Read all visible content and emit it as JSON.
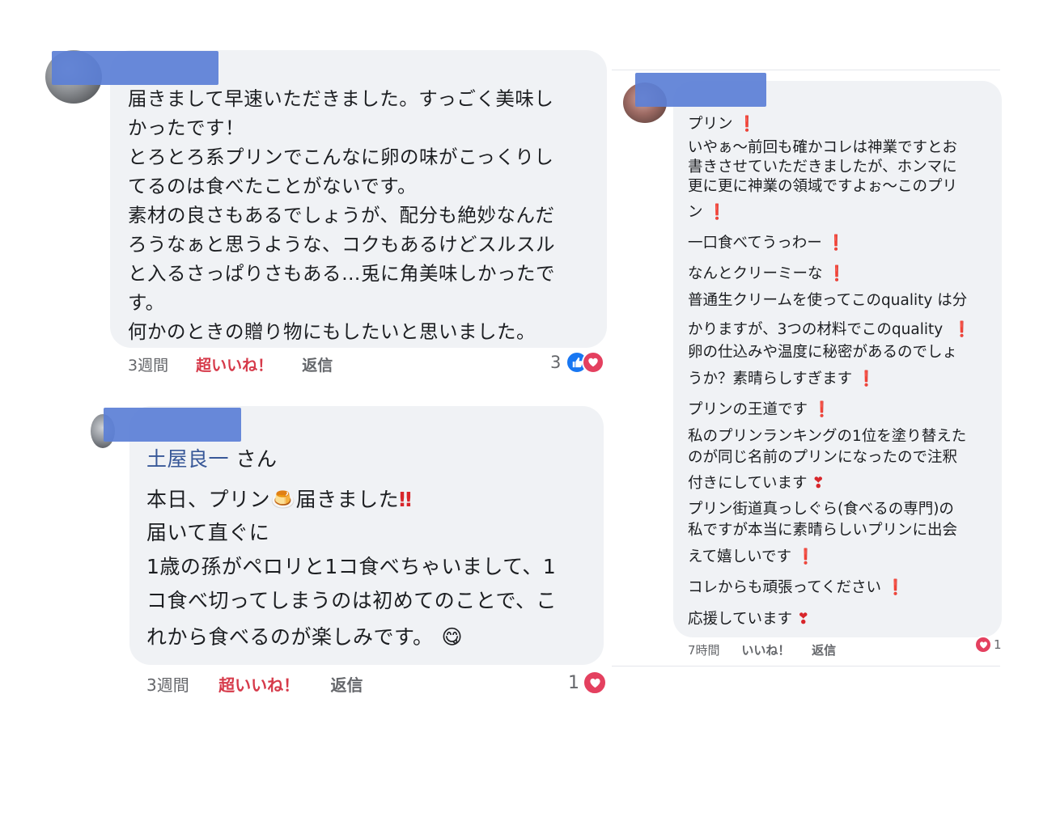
{
  "comment1": {
    "lines": [
      "届きまして早速いただきました。すっごく美味し",
      "かったです！",
      "とろとろ系プリンでこんなに卵の味がこっくりし",
      "てるのは食べたことがないです。",
      "素材の良さもあるでしょうが、配分も絶妙なんだ",
      "ろうなぁと思うような、コクもあるけどスルスル",
      "と入るさっぱりさもある…兎に角美味しかったで",
      "す。",
      "何かのときの贈り物にもしたいと思いました。"
    ],
    "time": "3週間",
    "like_label": "超いいね！",
    "reply_label": "返信",
    "reaction_count": "3"
  },
  "comment2": {
    "mention": "土屋良一",
    "mention_suffix": " さん",
    "line1_a": "本日、プリン",
    "line1_emoji": "🍮",
    "line1_b": "届きました",
    "line1_marks": "‼",
    "lines": [
      "届いて直ぐに",
      "1歳の孫がペロリと1コ食べちゃいまして、1",
      "コ食べ切ってしまうのは初めてのことで、こ"
    ],
    "last_line": "れから食べるのが楽しみです。",
    "last_emoji": "😋",
    "time": "3週間",
    "like_label": "超いいね！",
    "reply_label": "返信",
    "reaction_count": "1"
  },
  "comment3": {
    "lines": [
      {
        "text": "プリン",
        "mark": "❗"
      },
      {
        "text": "いやぁ～前回も確かコレは神業ですとお",
        "mark": ""
      },
      {
        "text": "書きさせていただきましたが、ホンマに",
        "mark": ""
      },
      {
        "text": "更に更に神業の領域ですよぉ～このプリ",
        "mark": ""
      },
      {
        "text": "ン",
        "mark": "❗"
      },
      {
        "text": "一口食べてうっわー",
        "mark": "❗"
      },
      {
        "text": "なんとクリーミーな",
        "mark": "❗"
      },
      {
        "text": "普通生クリームを使ってこのquality は分",
        "mark": ""
      },
      {
        "text": "かりますが、3つの材料でこのquality ",
        "mark": "❗"
      },
      {
        "text": "卵の仕込みや温度に秘密があるのでしょ",
        "mark": ""
      },
      {
        "text": "うか？素晴らしすぎます",
        "mark": "❗"
      },
      {
        "text": "プリンの王道です",
        "mark": "❗"
      },
      {
        "text": "私のプリンランキングの1位を塗り替えた",
        "mark": ""
      },
      {
        "text": "のが同じ名前のプリンになったので注釈",
        "mark": ""
      },
      {
        "text": "付きにしています",
        "mark": "❣"
      },
      {
        "text": "プリン街道真っしぐら(食べるの専門)の",
        "mark": ""
      },
      {
        "text": "私ですが本当に素晴らしいプリンに出会",
        "mark": ""
      },
      {
        "text": "えて嬉しいです",
        "mark": "❗"
      },
      {
        "text": "コレからも頑張ってください",
        "mark": "❗"
      },
      {
        "text": "応援しています",
        "mark": "❣"
      }
    ],
    "time": "7時間",
    "like_label": "いいね！",
    "reply_label": "返信",
    "reaction_count": "1"
  },
  "colors": {
    "bubble": "#f0f2f5",
    "meta": "#65676b",
    "super_like": "#d63a4a",
    "mention": "#385898",
    "blur": "#5b7fd6"
  }
}
